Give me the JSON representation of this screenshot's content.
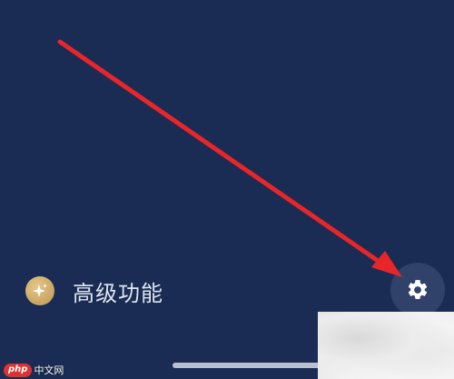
{
  "settings_panel": {
    "feature_label": "高级功能",
    "feature_icon": "sparkle-icon",
    "settings_icon": "gear-icon"
  },
  "annotation": {
    "type": "red-arrow",
    "color": "#e8262a",
    "points_to": "settings-button"
  },
  "watermark": {
    "badge": "php",
    "text": "中文网"
  },
  "colors": {
    "background": "#1a2c53",
    "label": "#dfe5f1",
    "icon_gold": "#c9a462",
    "button_bg": "#31426a"
  }
}
